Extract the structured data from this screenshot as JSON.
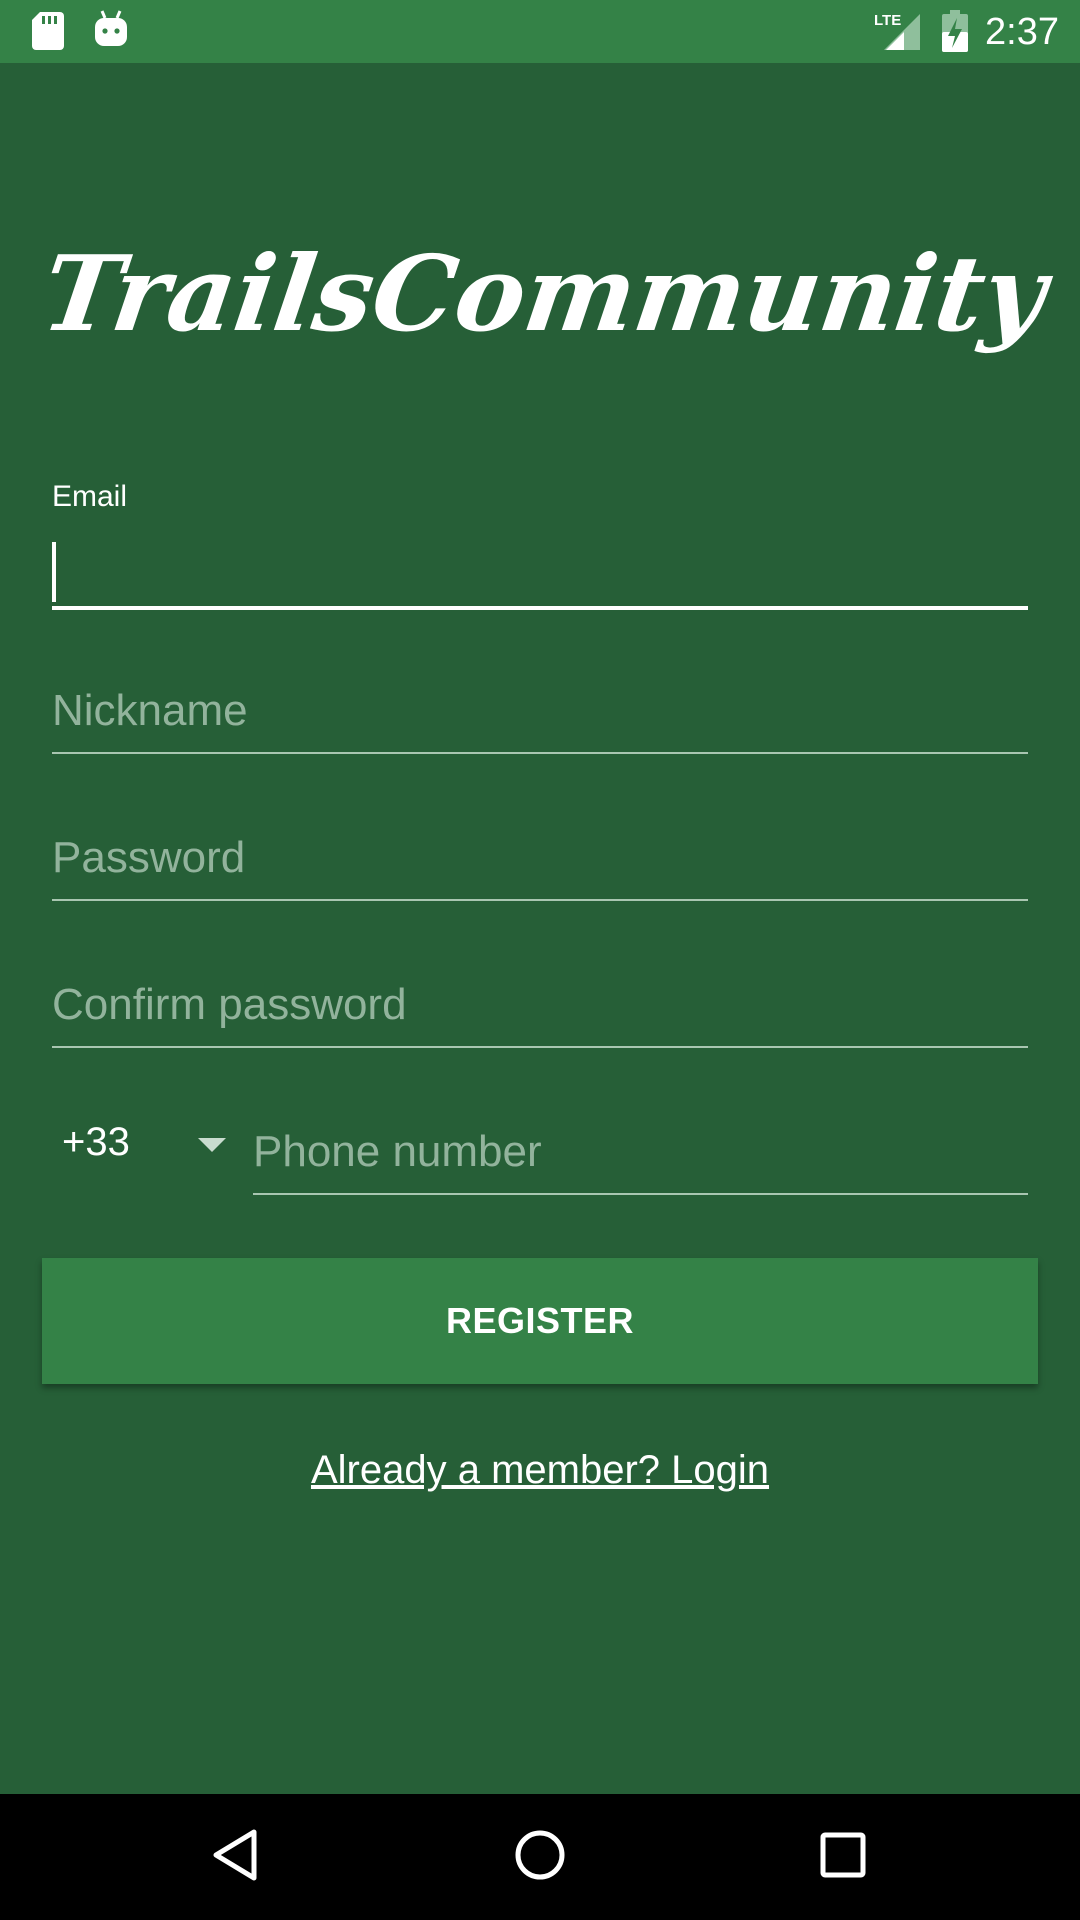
{
  "status_bar": {
    "time": "2:37",
    "network": "LTE",
    "icons": [
      "sd-card-icon",
      "android-icon",
      "lte-signal-icon",
      "battery-charging-icon"
    ]
  },
  "app": {
    "logo_text": "TrailsCommunity"
  },
  "form": {
    "email": {
      "label": "Email",
      "value": "",
      "placeholder": ""
    },
    "nickname": {
      "placeholder": "Nickname",
      "value": ""
    },
    "password": {
      "placeholder": "Password",
      "value": ""
    },
    "confirm_password": {
      "placeholder": "Confirm password",
      "value": ""
    },
    "country_code": "+33",
    "phone": {
      "placeholder": "Phone number",
      "value": ""
    },
    "register_label": "REGISTER",
    "login_link": "Already a member? Login"
  },
  "nav": {
    "icons": [
      "back-icon",
      "home-icon",
      "recents-icon"
    ]
  },
  "colors": {
    "background": "#265f37",
    "status_bar": "#348247",
    "button": "#348247",
    "hint": "#92b39c",
    "text": "#ffffff"
  }
}
